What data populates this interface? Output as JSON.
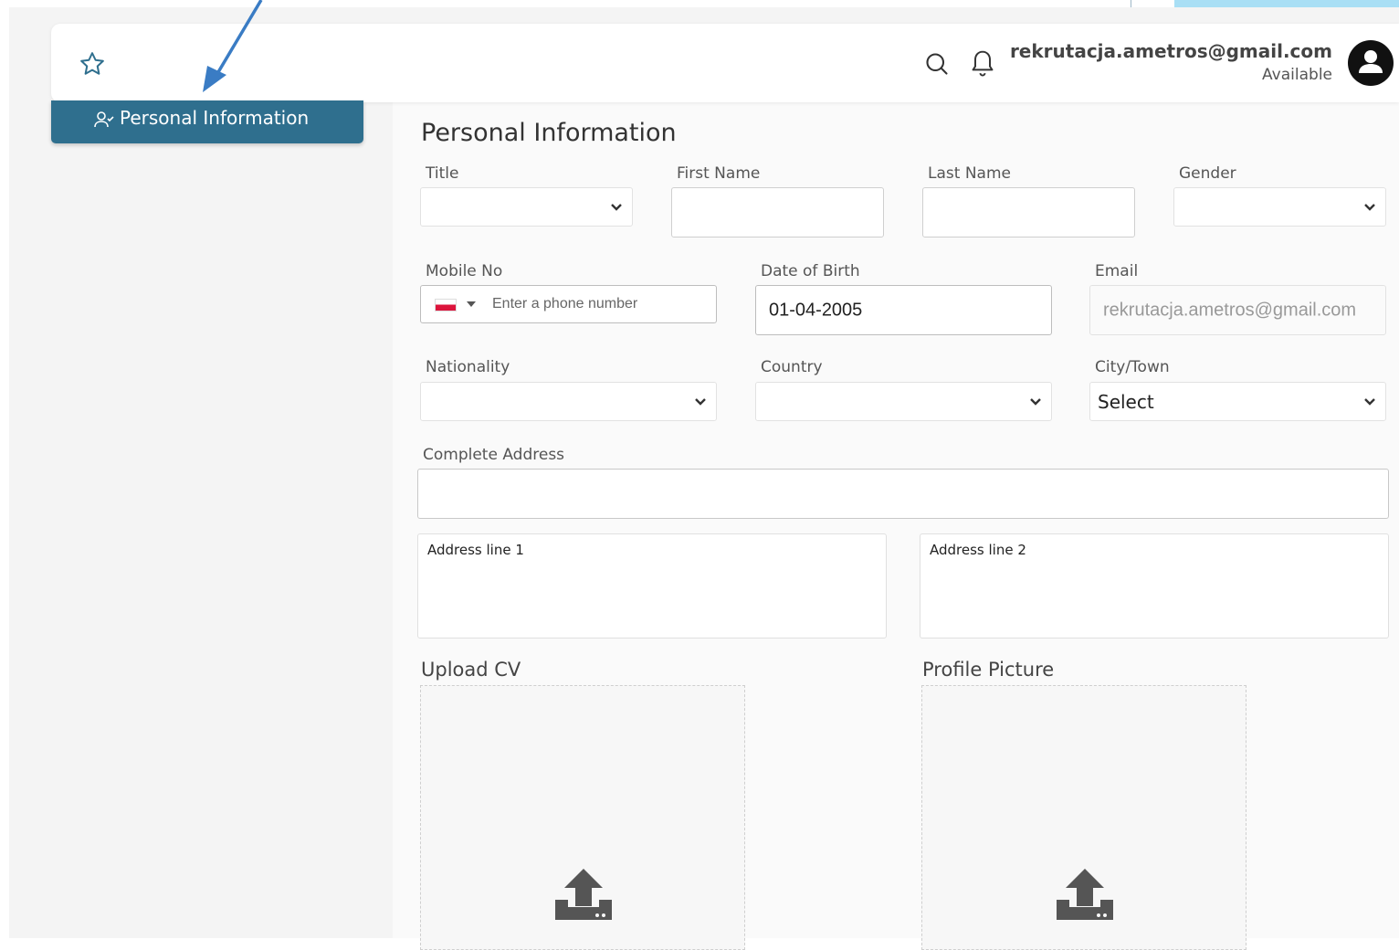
{
  "topbar": {
    "user_email": "rekrutacja.ametros@gmail.com",
    "user_status": "Available"
  },
  "sidebar": {
    "active_item": "Personal Information"
  },
  "form": {
    "section_title": "Personal Information",
    "title": {
      "label": "Title",
      "value": ""
    },
    "first_name": {
      "label": "First Name",
      "value": ""
    },
    "last_name": {
      "label": "Last Name",
      "value": ""
    },
    "gender": {
      "label": "Gender",
      "value": ""
    },
    "mobile": {
      "label": "Mobile No",
      "placeholder": "Enter a phone number",
      "country_flag": "Poland"
    },
    "dob": {
      "label": "Date of Birth",
      "value": "01-04-2005"
    },
    "email": {
      "label": "Email",
      "value": "rekrutacja.ametros@gmail.com"
    },
    "nationality": {
      "label": "Nationality",
      "value": ""
    },
    "country": {
      "label": "Country",
      "value": ""
    },
    "city": {
      "label": "City/Town",
      "value": "Select"
    },
    "complete_address": {
      "label": "Complete Address",
      "value": ""
    },
    "address_line1": {
      "label": "Address line 1"
    },
    "address_line2": {
      "label": "Address line 2"
    },
    "upload_cv": {
      "label": "Upload CV"
    },
    "profile_picture": {
      "label": "Profile Picture"
    }
  },
  "colors": {
    "accent": "#2f6f8e",
    "annotation_arrow": "#3a7cc4"
  }
}
